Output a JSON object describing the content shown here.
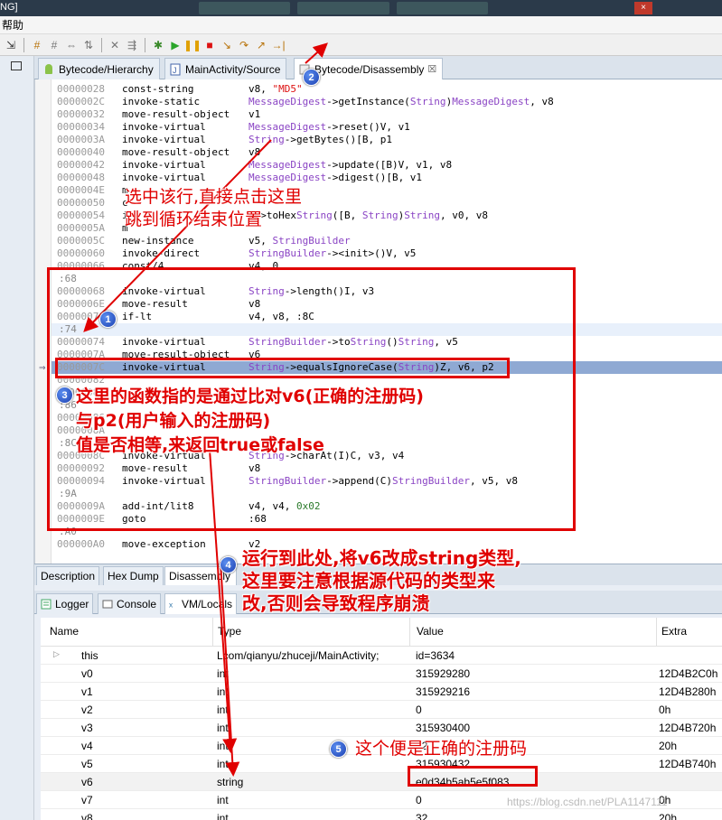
{
  "window": {
    "title_fragment": "NG]",
    "close_icon": "×"
  },
  "menu": {
    "help": "帮助"
  },
  "tabs": [
    {
      "label": "Bytecode/Hierarchy",
      "icon": "android-icon"
    },
    {
      "label": "MainActivity/Source",
      "icon": "java-file-icon"
    },
    {
      "label": "Bytecode/Disassembly",
      "icon": "disassembly-icon",
      "close": "☒"
    }
  ],
  "code": [
    {
      "addr": "00000028",
      "op": "const-string",
      "args": "v8, \"MD5\""
    },
    {
      "addr": "0000002C",
      "op": "invoke-static",
      "args": "MessageDigest->getInstance(String)MessageDigest, v8"
    },
    {
      "addr": "00000032",
      "op": "move-result-object",
      "args": "v1"
    },
    {
      "addr": "00000034",
      "op": "invoke-virtual",
      "args": "MessageDigest->reset()V, v1"
    },
    {
      "addr": "0000003A",
      "op": "invoke-virtual",
      "args": "String->getBytes()[B, p1"
    },
    {
      "addr": "00000040",
      "op": "move-result-object",
      "args": "v8"
    },
    {
      "addr": "00000042",
      "op": "invoke-virtual",
      "args": "MessageDigest->update([B)V, v1, v8"
    },
    {
      "addr": "00000048",
      "op": "invoke-virtual",
      "args": "MessageDigest->digest()[B, v1"
    },
    {
      "addr": "0000004E",
      "op": "m",
      "args": ""
    },
    {
      "addr": "00000050",
      "op": "c",
      "args": ""
    },
    {
      "addr": "00000054",
      "op": "i",
      "args": "y->toHexString([B, String)String, v0, v8"
    },
    {
      "addr": "0000005A",
      "op": "m",
      "args": ""
    },
    {
      "addr": "0000005C",
      "op": "new-instance",
      "args": "v5, StringBuilder"
    },
    {
      "addr": "00000060",
      "op": "invoke-direct",
      "args": "StringBuilder-><init>()V, v5"
    },
    {
      "addr": "00000066",
      "op": "const/4",
      "args": "v4, 0"
    },
    {
      "label": ":68"
    },
    {
      "addr": "00000068",
      "op": "invoke-virtual",
      "args": "String->length()I, v3"
    },
    {
      "addr": "0000006E",
      "op": "move-result",
      "args": "v8"
    },
    {
      "addr": "00000070",
      "op": "if-lt",
      "args": "v4, v8, :8C"
    },
    {
      "label": ":74"
    },
    {
      "addr": "00000074",
      "op": "invoke-virtual",
      "args": "StringBuilder->toString()String, v5"
    },
    {
      "addr": "0000007A",
      "op": "move-result-object",
      "args": "v6"
    },
    {
      "addr": "0000007C",
      "op": "invoke-virtual",
      "args": "String->equalsIgnoreCase(String)Z, v6, p2"
    },
    {
      "addr": "00000082",
      "op": "",
      "args": ""
    },
    {
      "addr": "00000084",
      "op": "",
      "args": ""
    },
    {
      "label": ":86"
    },
    {
      "addr": "00000086",
      "op": "",
      "args": ""
    },
    {
      "addr": "0000008A",
      "op": "",
      "args": ""
    },
    {
      "label": ":8C"
    },
    {
      "addr": "0000008C",
      "op": "invoke-virtual",
      "args": "String->charAt(I)C, v3, v4"
    },
    {
      "addr": "00000092",
      "op": "move-result",
      "args": "v8"
    },
    {
      "addr": "00000094",
      "op": "invoke-virtual",
      "args": "StringBuilder->append(C)StringBuilder, v5, v8"
    },
    {
      "label": ":9A"
    },
    {
      "addr": "0000009A",
      "op": "add-int/lit8",
      "args": "v4, v4, 0x02"
    },
    {
      "addr": "0000009E",
      "op": "goto",
      "args": ":68"
    },
    {
      "label": ":A0"
    },
    {
      "addr": "000000A0",
      "op": "move-exception",
      "args": "v2"
    }
  ],
  "bottom_tabs": [
    "Description",
    "Hex Dump",
    "Disassembly"
  ],
  "view_tabs": [
    "Logger",
    "Console",
    "VM/Locals"
  ],
  "vars_header": {
    "name": "Name",
    "type": "Type",
    "value": "Value",
    "extra": "Extra"
  },
  "vars": [
    {
      "name": "this",
      "type": "Lcom/qianyu/zhuceji/MainActivity;",
      "value": "id=3634",
      "extra": ""
    },
    {
      "name": "v0",
      "type": "int",
      "value": "315929280",
      "extra": "12D4B2C0h"
    },
    {
      "name": "v1",
      "type": "int",
      "value": "315929216",
      "extra": "12D4B280h"
    },
    {
      "name": "v2",
      "type": "int",
      "value": "0",
      "extra": "0h"
    },
    {
      "name": "v3",
      "type": "int",
      "value": "315930400",
      "extra": "12D4B720h"
    },
    {
      "name": "v4",
      "type": "int",
      "value": "32",
      "extra": "20h"
    },
    {
      "name": "v5",
      "type": "int",
      "value": "315930432",
      "extra": "12D4B740h"
    },
    {
      "name": "v6",
      "type": "string",
      "value": "e0d34b5ab5e5f083",
      "extra": ""
    },
    {
      "name": "v7",
      "type": "int",
      "value": "0",
      "extra": "0h"
    },
    {
      "name": "v8",
      "type": "int",
      "value": "32",
      "extra": "20h"
    }
  ],
  "annotations": {
    "a1_line1": "选中该行,直接点击这里",
    "a1_line2": "跳到循环结束位置",
    "a3_line1": "这里的函数指的是通过比对v6(正确的注册码)",
    "a3_line2": "与p2(用户输入的注册码)",
    "a3_line3": "值是否相等,来返回true或false",
    "a4_line1": "运行到此处,将v6改成string类型,",
    "a4_line2": "这里要注意根据源代码的类型来",
    "a4_line3": "改,否则会导致程序崩溃",
    "a5": "这个便是正确的注册码",
    "n1": "1",
    "n2": "2",
    "n3": "3",
    "n4": "4",
    "n5": "5"
  },
  "watermark": "https://blog.csdn.net/PLA1147111",
  "colors": {
    "annotation": "#e00000",
    "selection": "#8fa9d3",
    "type_purple": "#8a44c4"
  }
}
